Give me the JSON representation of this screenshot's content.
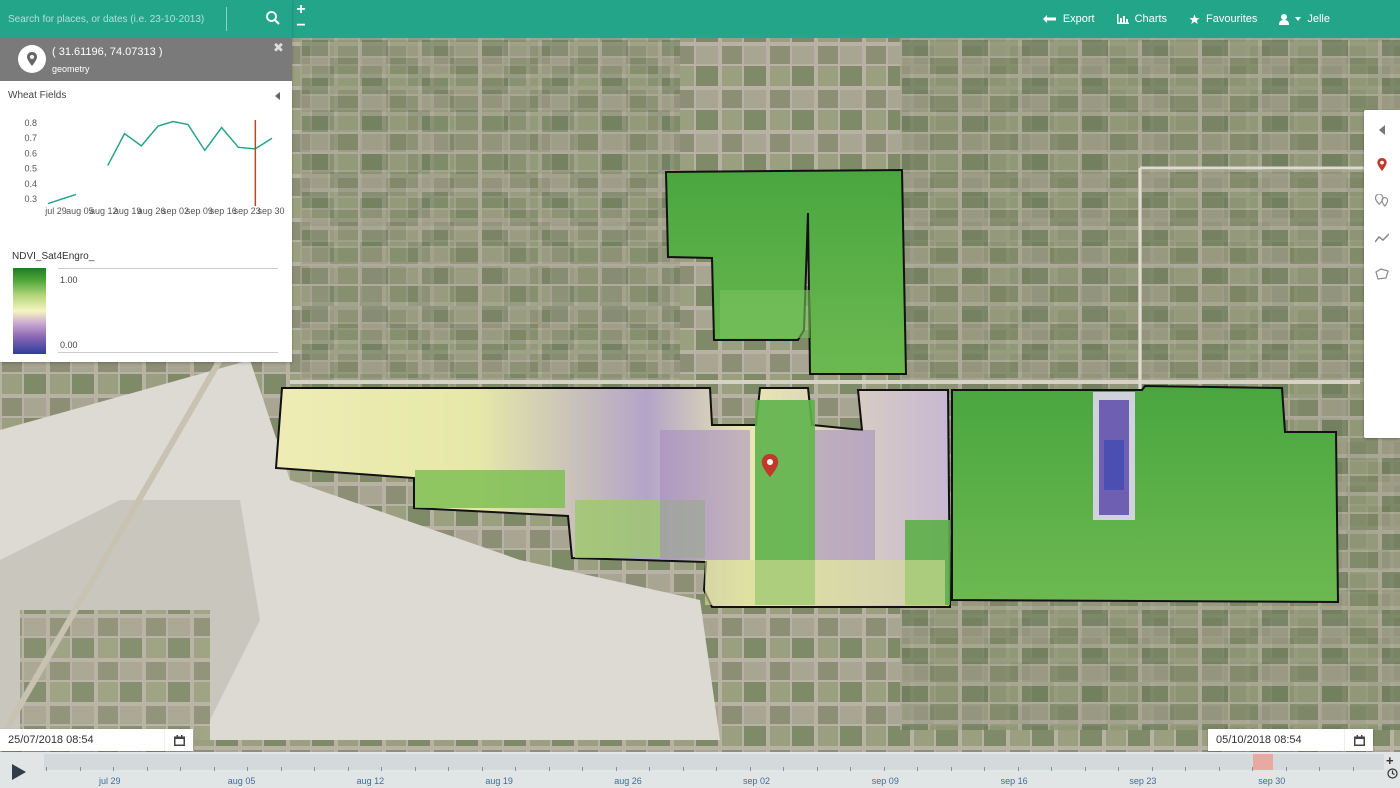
{
  "search": {
    "placeholder": "Search for places, or dates (i.e. 23-10-2013)"
  },
  "zoom": {
    "in": "+",
    "out": "−"
  },
  "nav": {
    "export": "Export",
    "charts": "Charts",
    "favourites": "Favourites",
    "user": "Jelle"
  },
  "location": {
    "coords": "( 31.61196, 74.07313 )",
    "type": "geometry",
    "close": "✖"
  },
  "panel": {
    "title": "Wheat Fields"
  },
  "chart_data": {
    "type": "line",
    "x": [
      "jul 29",
      "aug 05",
      "aug 12",
      "aug 19",
      "aug 26",
      "sep 02",
      "sep 09",
      "sep 16",
      "sep 23",
      "sep 30"
    ],
    "yticks": [
      "0.8",
      "0.7",
      "0.6",
      "0.5",
      "0.4",
      "0.3"
    ],
    "ylim": [
      0.3,
      0.8
    ],
    "series": [
      {
        "points": [
          [
            0,
            0.27
          ],
          [
            1.5,
            0.33
          ]
        ]
      },
      {
        "points": [
          [
            3.2,
            0.52
          ],
          [
            4.1,
            0.73
          ],
          [
            5,
            0.65
          ],
          [
            5.9,
            0.78
          ],
          [
            6.7,
            0.81
          ],
          [
            7.5,
            0.79
          ],
          [
            8.4,
            0.62
          ],
          [
            9.3,
            0.77
          ],
          [
            10.2,
            0.64
          ],
          [
            11.1,
            0.63
          ],
          [
            12,
            0.7
          ]
        ]
      }
    ],
    "marker_index": 11,
    "line_color": "#26a28f",
    "marker_color": "#b5472b"
  },
  "legend": {
    "title": "NDVI_Sat4Engro_",
    "max": "1.00",
    "min": "0.00"
  },
  "dates": {
    "start": "25/07/2018 08:54",
    "end": "05/10/2018 08:54"
  },
  "timeline": {
    "labels": [
      "jul 29",
      "aug 05",
      "aug 12",
      "aug 19",
      "aug 26",
      "sep 02",
      "sep 09",
      "sep 16",
      "sep 23",
      "sep 30"
    ]
  },
  "colors": {
    "accent": "#23a58a",
    "pin": "#c0392b"
  }
}
